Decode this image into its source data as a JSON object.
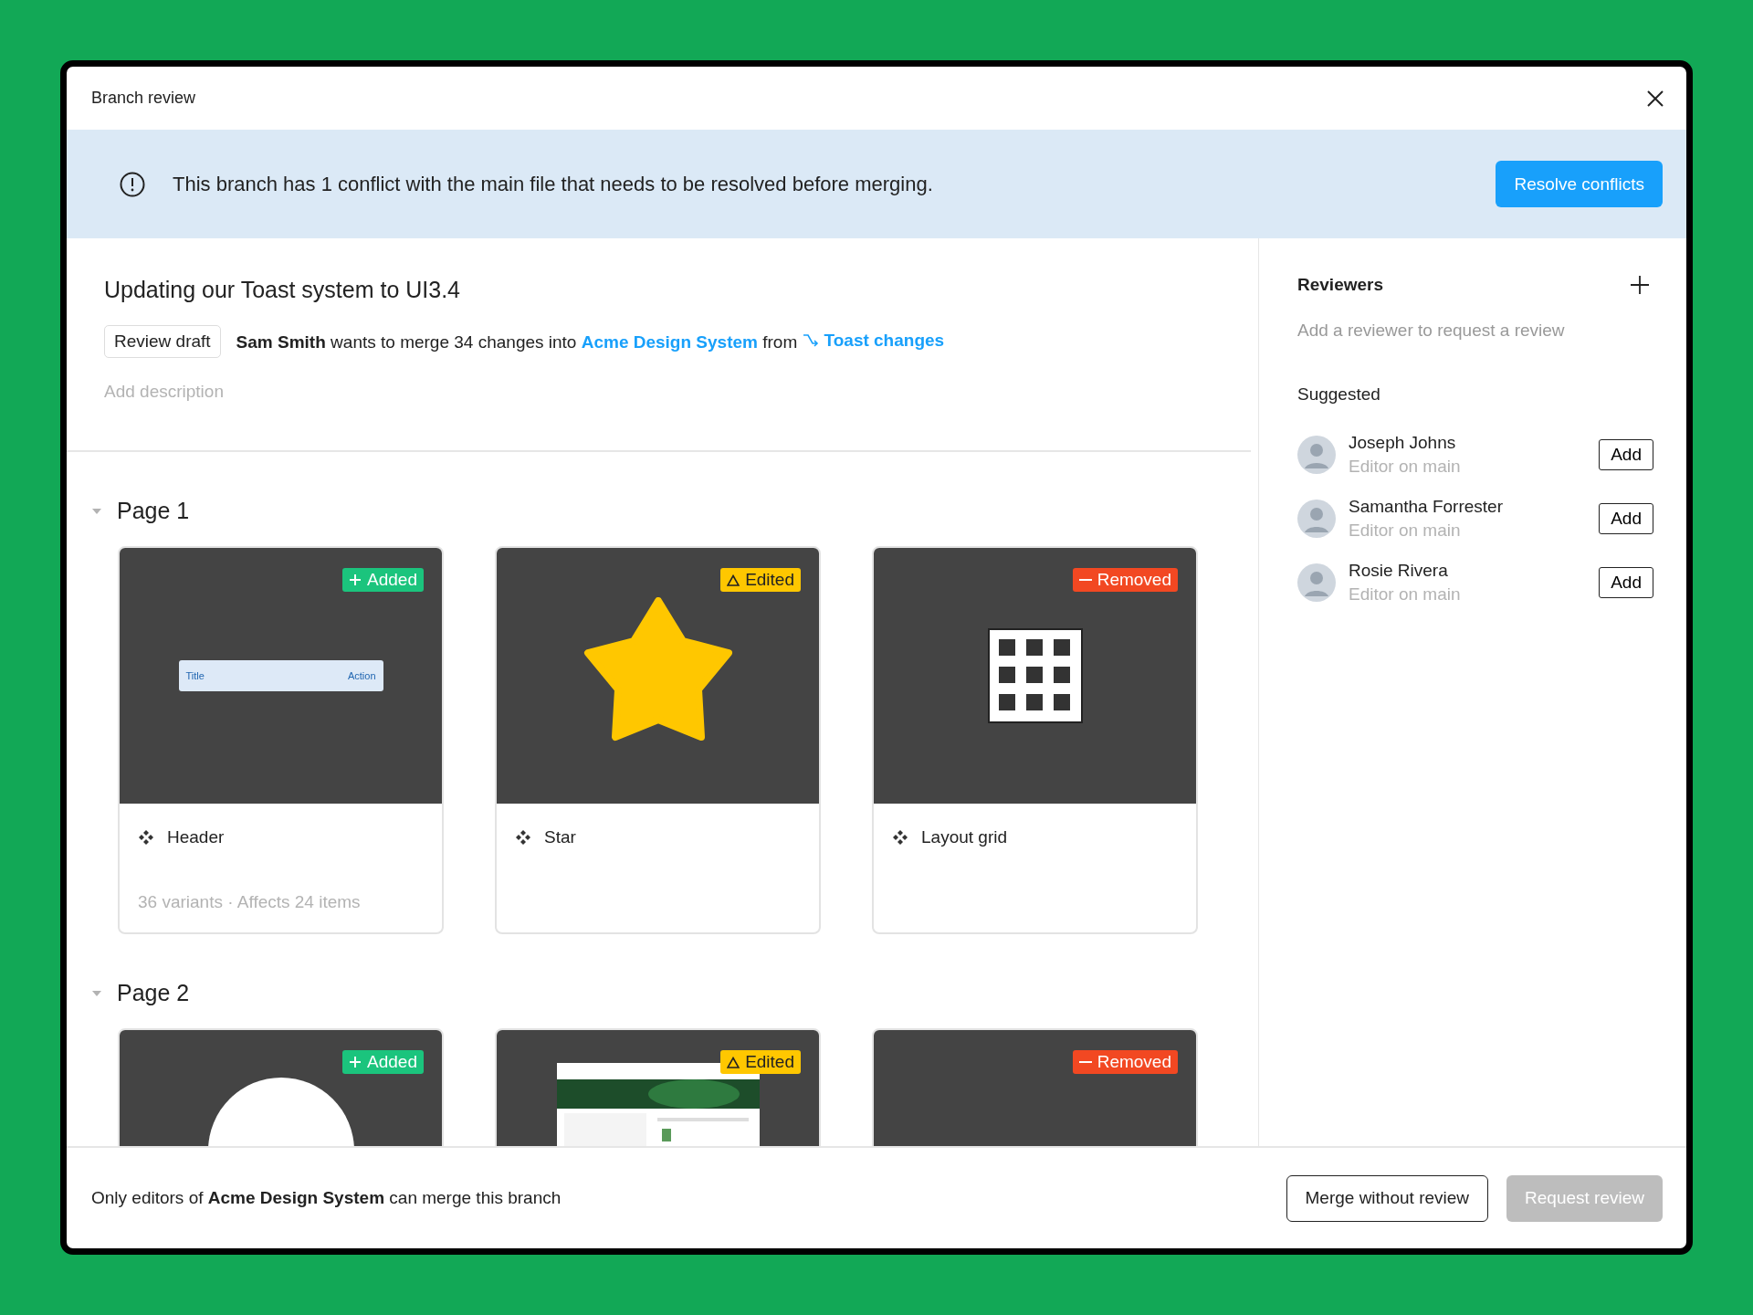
{
  "window": {
    "title": "Branch review"
  },
  "banner": {
    "message": "This branch has 1 conflict with the main file that needs to be resolved before merging.",
    "action": "Resolve conflicts"
  },
  "branch": {
    "title": "Updating our Toast system to UI3.4",
    "status": "Review draft",
    "summary": "**Sam Smith** wants to merge 34 changes into",
    "target": "Acme Design System",
    "joiner": "from",
    "source": "Toast changes",
    "description_placeholder": "Add description"
  },
  "pages": [
    {
      "name": "Page 1",
      "expanded": true,
      "components": [
        {
          "name": "Header",
          "kind": "added",
          "change_label": "Added",
          "preview": {
            "kind": "toast",
            "title": "Title",
            "action": "Action"
          },
          "details": "36 variants · Affects 24 items"
        },
        {
          "name": "Star",
          "kind": "edited",
          "change_label": "Edited",
          "preview": {
            "kind": "star"
          }
        },
        {
          "name": "Layout grid",
          "kind": "removed",
          "change_label": "Removed",
          "preview": {
            "kind": "grid"
          }
        }
      ]
    },
    {
      "name": "Page 2",
      "expanded": true,
      "components": [
        {
          "kind": "added",
          "change_label": "Added",
          "preview": {
            "kind": "circle"
          }
        },
        {
          "kind": "edited",
          "change_label": "Edited",
          "preview": {
            "kind": "webpage"
          }
        },
        {
          "kind": "removed",
          "change_label": "Removed",
          "preview": {
            "kind": "blank"
          }
        }
      ]
    }
  ],
  "reviewers": {
    "title": "Reviewers",
    "empty": "Add a reviewer to request a review",
    "suggested_title": "Suggested",
    "suggested": [
      {
        "name": "Joseph Johns",
        "role": "Editor on main",
        "action": "Add"
      },
      {
        "name": "Samantha Forrester",
        "role": "Editor on main",
        "action": "Add"
      },
      {
        "name": "Rosie Rivera",
        "role": "Editor on main",
        "action": "Add"
      }
    ]
  },
  "footer": {
    "note": "Only editors of **Acme Design System** can merge this branch",
    "buttons": [
      {
        "label": "Merge without review",
        "kind": "secondary",
        "disabled": false
      },
      {
        "label": "Request review",
        "kind": "primary",
        "disabled": true
      }
    ]
  }
}
